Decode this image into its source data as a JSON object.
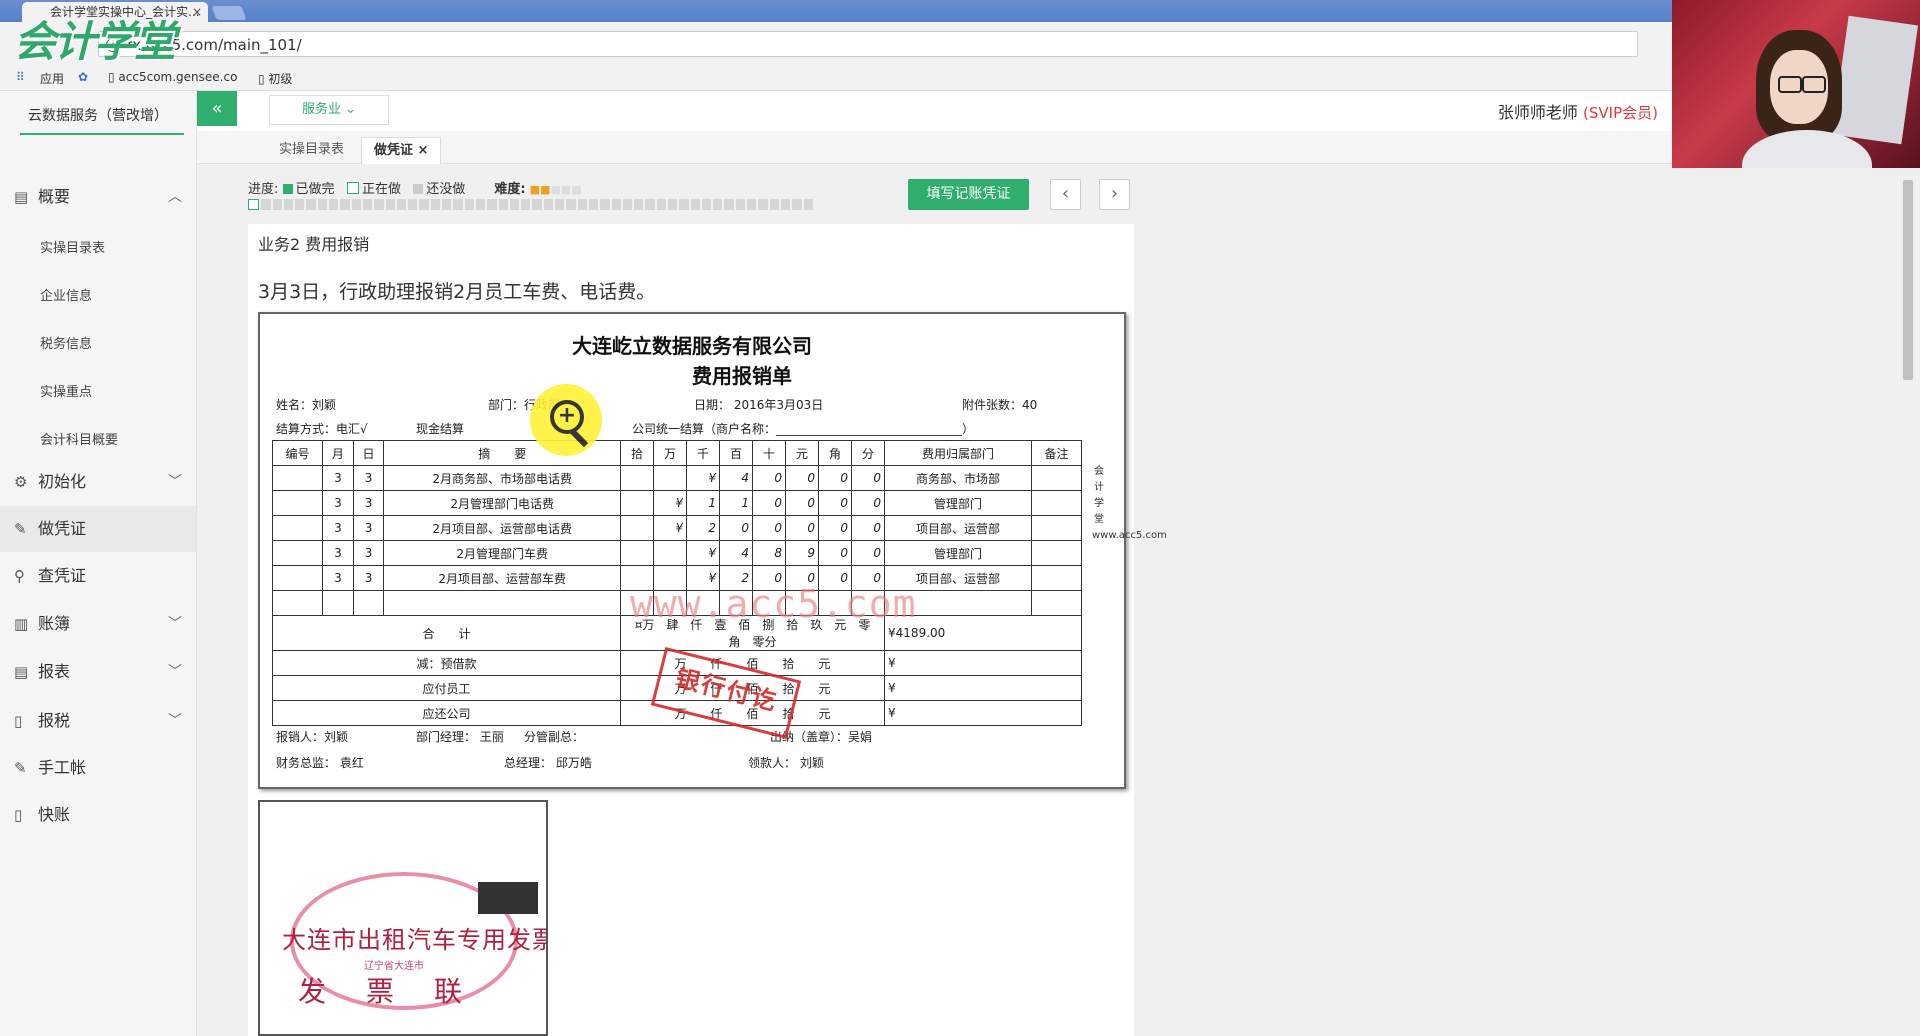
{
  "browser": {
    "tab_title": "会计学堂实操中心_会计实...",
    "tab_close": "×",
    "url": "fx.acc5.com/main_101/",
    "bookmarks": [
      "应用",
      "acc5com.gensee.co",
      "初级"
    ]
  },
  "logo": "会计学堂",
  "sidebar": {
    "title": "云数据服务（营改增）",
    "menus": [
      {
        "icon": "▤",
        "label": "概要",
        "chevron": "︿"
      },
      {
        "icon": "⚙",
        "label": "初始化",
        "chevron": "﹀"
      },
      {
        "icon": "✎",
        "label": "做凭证",
        "chevron": ""
      },
      {
        "icon": "⚲",
        "label": "查凭证",
        "chevron": ""
      },
      {
        "icon": "▥",
        "label": "账簿",
        "chevron": "﹀"
      },
      {
        "icon": "▤",
        "label": "报表",
        "chevron": "﹀"
      },
      {
        "icon": "▯",
        "label": "报税",
        "chevron": "﹀"
      },
      {
        "icon": "✎",
        "label": "手工帐",
        "chevron": ""
      },
      {
        "icon": "▯",
        "label": "快账",
        "chevron": ""
      }
    ],
    "sub_items": [
      "实操目录表",
      "企业信息",
      "税务信息",
      "实操重点",
      "会计科目概要"
    ]
  },
  "topbar": {
    "collapse": "«",
    "industry": "服务业 ⌄",
    "user": "张师师老师",
    "vip": "(SVIP会员)"
  },
  "tabs": [
    {
      "label": "实操目录表"
    },
    {
      "label": "做凭证 ×"
    }
  ],
  "progress": {
    "label": "进度:",
    "done": "已做完",
    "doing": "正在做",
    "todo": "还没做",
    "difficulty_label": "难度:",
    "difficulty": 2,
    "difficulty_max": 5,
    "total_steps": 50,
    "current_step": 1
  },
  "buttons": {
    "fill": "填写记账凭证",
    "prev": "‹",
    "next": "›"
  },
  "task": {
    "title": "业务2 费用报销",
    "desc": "3月3日，行政助理报销2月员工车费、电话费。"
  },
  "voucher": {
    "company": "大连屹立数据服务有限公司",
    "title": "费用报销单",
    "name": "姓名：刘颖",
    "dept": "部门：行政部",
    "date": "日期： 2016年3月03日",
    "attach": "附件张数：40",
    "settle": "结算方式：电汇√",
    "cash": "现金结算",
    "unified": "公司统一结算（商户名称：_______________________________）",
    "headers": [
      "编号",
      "月",
      "日",
      "摘　　要",
      "拾",
      "万",
      "千",
      "百",
      "十",
      "元",
      "角",
      "分",
      "费用归属部门",
      "备注"
    ],
    "rows": [
      {
        "m": "3",
        "d": "3",
        "sum": "2月商务部、市场部电话费",
        "digits": [
          "",
          "",
          "¥",
          "4",
          "0",
          "0",
          "0",
          "0"
        ],
        "dept": "商务部、市场部"
      },
      {
        "m": "3",
        "d": "3",
        "sum": "2月管理部门电话费",
        "digits": [
          "",
          "¥",
          "1",
          "1",
          "0",
          "0",
          "0",
          "0"
        ],
        "dept": "管理部门"
      },
      {
        "m": "3",
        "d": "3",
        "sum": "2月项目部、运营部电话费",
        "digits": [
          "",
          "¥",
          "2",
          "0",
          "0",
          "0",
          "0",
          "0"
        ],
        "dept": "项目部、运营部"
      },
      {
        "m": "3",
        "d": "3",
        "sum": "2月管理部门车费",
        "digits": [
          "",
          "",
          "¥",
          "4",
          "8",
          "9",
          "0",
          "0"
        ],
        "dept": "管理部门"
      },
      {
        "m": "3",
        "d": "3",
        "sum": "2月项目部、运营部车费",
        "digits": [
          "",
          "",
          "¥",
          "2",
          "0",
          "0",
          "0",
          "0"
        ],
        "dept": "项目部、运营部"
      }
    ],
    "total_label": "合　　计",
    "total_words": "¤万　肆　仟　壹　佰　捌　拾　玖　元　零　角　零分",
    "total_value": "¥4189.00",
    "sub_rows": [
      {
        "label": "减：预借款",
        "words": "万　　仟　　佰　　拾　　元",
        "value": "¥"
      },
      {
        "label": "应付员工",
        "words": "万　　仟　　佰　　拾　　元",
        "value": "¥"
      },
      {
        "label": "应还公司",
        "words": "万　　仟　　佰　　拾　　元",
        "value": "¥"
      }
    ],
    "footer1": [
      "报销人：刘颖",
      "部门经理： 王丽",
      "分管副总：",
      "出纳（盖章）：吴娟"
    ],
    "footer2": [
      "财务总监： 袁红",
      "总经理： 邱万皓",
      "领款人： 刘颖"
    ],
    "side_text": "会计学堂www.acc5.com",
    "stamp": "银行付讫",
    "watermark": "www.acc5.com"
  },
  "receipt": {
    "title": "大连市出租汽车专用发票",
    "sub": "辽宁省大连市",
    "big": "发票联"
  },
  "colors": {
    "accent": "#2fae6e",
    "vip": "#e0393e",
    "stamp": "#d42a2a"
  }
}
